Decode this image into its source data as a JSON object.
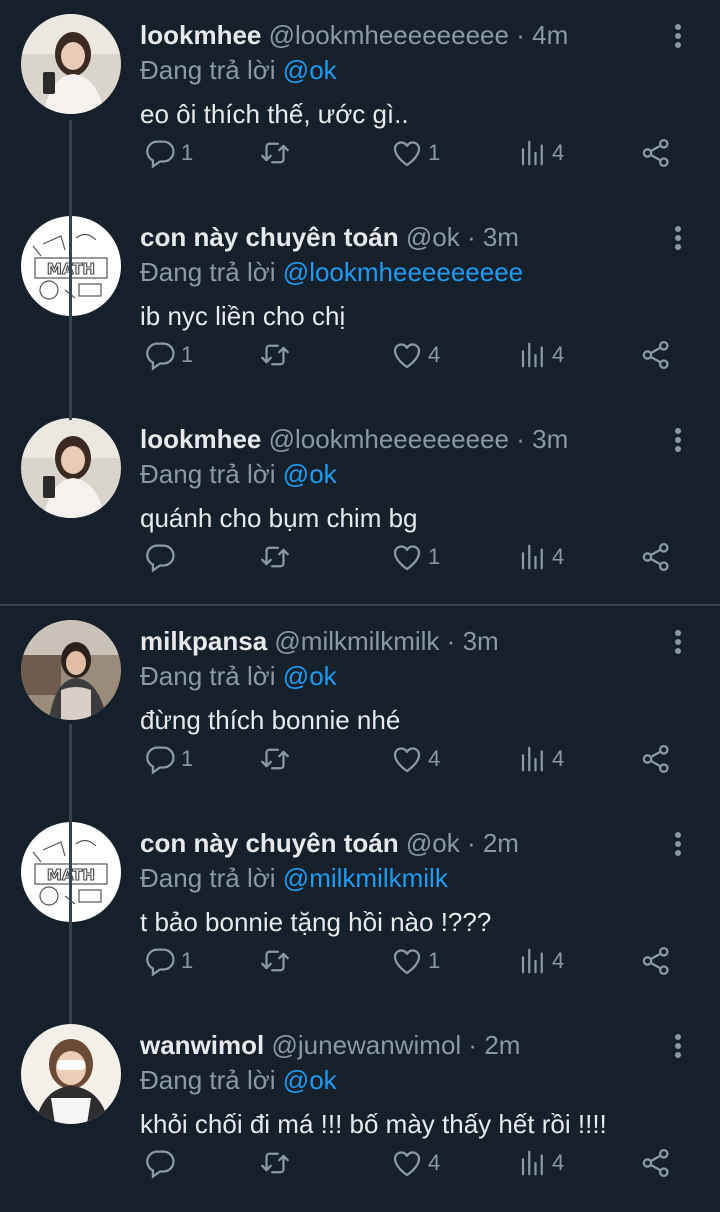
{
  "tweets": [
    {
      "name": "lookmhee",
      "handle": "@lookmheeeeeeeee",
      "sep": "·",
      "time": "4m",
      "replying_prefix": "Đang trả lời",
      "replying_to": "@ok",
      "text": "eo ôi thích thế, ước gì..",
      "reply_count": "1",
      "retweet_count": "",
      "like_count": "1",
      "view_count": "4",
      "avatar": "photo-girl"
    },
    {
      "name": "con này chuyên toán",
      "handle": "@ok",
      "sep": "·",
      "time": "3m",
      "replying_prefix": "Đang trả lời",
      "replying_to": "@lookmheeeeeeeee",
      "text": "ib nyc liền cho chị",
      "reply_count": "1",
      "retweet_count": "",
      "like_count": "4",
      "view_count": "4",
      "avatar": "math-doodle"
    },
    {
      "name": "lookmhee",
      "handle": "@lookmheeeeeeeee",
      "sep": "·",
      "time": "3m",
      "replying_prefix": "Đang trả lời",
      "replying_to": "@ok",
      "text": "quánh cho bụm chim bg",
      "reply_count": "",
      "retweet_count": "",
      "like_count": "1",
      "view_count": "4",
      "avatar": "photo-girl"
    },
    {
      "name": "milkpansa",
      "handle": "@milkmilkmilk",
      "sep": "·",
      "time": "3m",
      "replying_prefix": "Đang trả lời",
      "replying_to": "@ok",
      "text": "đừng thích bonnie nhé",
      "reply_count": "1",
      "retweet_count": "",
      "like_count": "4",
      "view_count": "4",
      "avatar": "photo-outdoor"
    },
    {
      "name": "con này chuyên toán",
      "handle": "@ok",
      "sep": "·",
      "time": "2m",
      "replying_prefix": "Đang trả lời",
      "replying_to": "@milkmilkmilk",
      "text": "t bảo bonnie tặng hồi nào !???",
      "reply_count": "1",
      "retweet_count": "",
      "like_count": "1",
      "view_count": "4",
      "avatar": "math-doodle"
    },
    {
      "name": "wanwimol",
      "handle": "@junewanwimol",
      "sep": "·",
      "time": "2m",
      "replying_prefix": "Đang trả lời",
      "replying_to": "@ok",
      "text": "khỏi chối đi má !!! bố mày thấy hết rồi !!!!",
      "reply_count": "",
      "retweet_count": "",
      "like_count": "4",
      "view_count": "4",
      "avatar": "photo-selfie"
    }
  ],
  "colors": {
    "background": "#15202b",
    "text": "#e7e9ea",
    "muted": "#8b98a5",
    "mention": "#1d9bf0",
    "line": "#38444d"
  },
  "icons": {
    "reply": "reply-icon",
    "retweet": "retweet-icon",
    "like": "heart-icon",
    "views": "views-icon",
    "share": "share-icon",
    "menu": "more-icon"
  }
}
